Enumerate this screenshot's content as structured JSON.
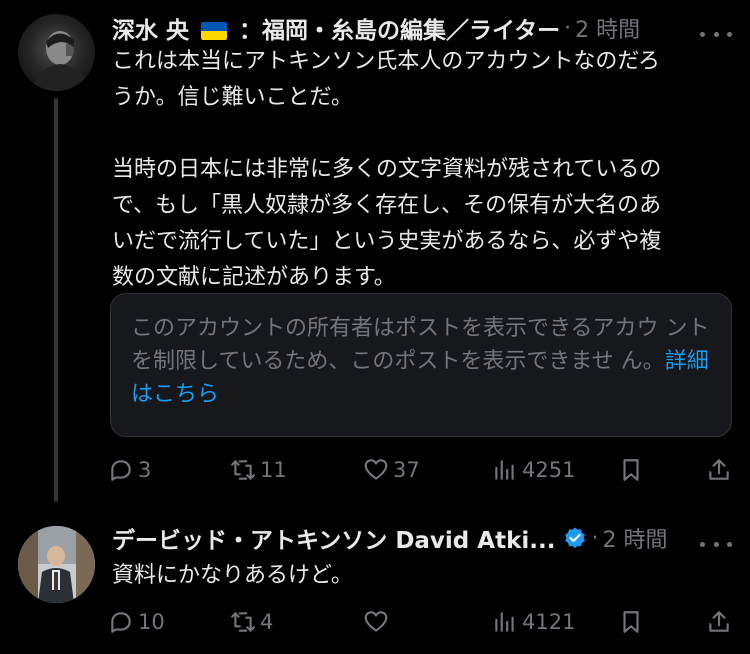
{
  "posts": [
    {
      "author": {
        "name_part1": "深水 央",
        "name_part2": "：福岡・糸島の編集／ライター",
        "flag": "ukraine-flag"
      },
      "dot": "·",
      "time": "2 時間",
      "body": "これは本当にアトキンソン氏本人のアカウントなのだろ\nうか。信じ難いことだ。\n\n当時の日本には非常に多くの文字資料が残されているの\nで、もし「黒人奴隷が多く存在し、その保有が大名のあ\nいだで流行していた」という史実があるなら、必ずや複\n数の文献に記述があります。",
      "notice": {
        "text": "このアカウントの所有者はポストを表示できるアカウ\nントを制限しているため、このポストを表示できませ\nん。",
        "link": "詳細はこちら"
      },
      "actions": {
        "replies": "3",
        "reposts": "11",
        "likes": "37",
        "views": "4251"
      }
    },
    {
      "author": {
        "name": "デービッド・アトキンソン David Atki...",
        "verified": true
      },
      "dot": "·",
      "time": "2 時間",
      "body": "資料にかなりあるけど。",
      "actions": {
        "replies": "10",
        "reposts": "4",
        "likes": "",
        "views": "4121"
      }
    }
  ],
  "colors": {
    "background": "#000000",
    "text": "#e7e9ea",
    "muted": "#71767b",
    "accent": "#1d9bf0",
    "verified": "#1d9bf0"
  }
}
